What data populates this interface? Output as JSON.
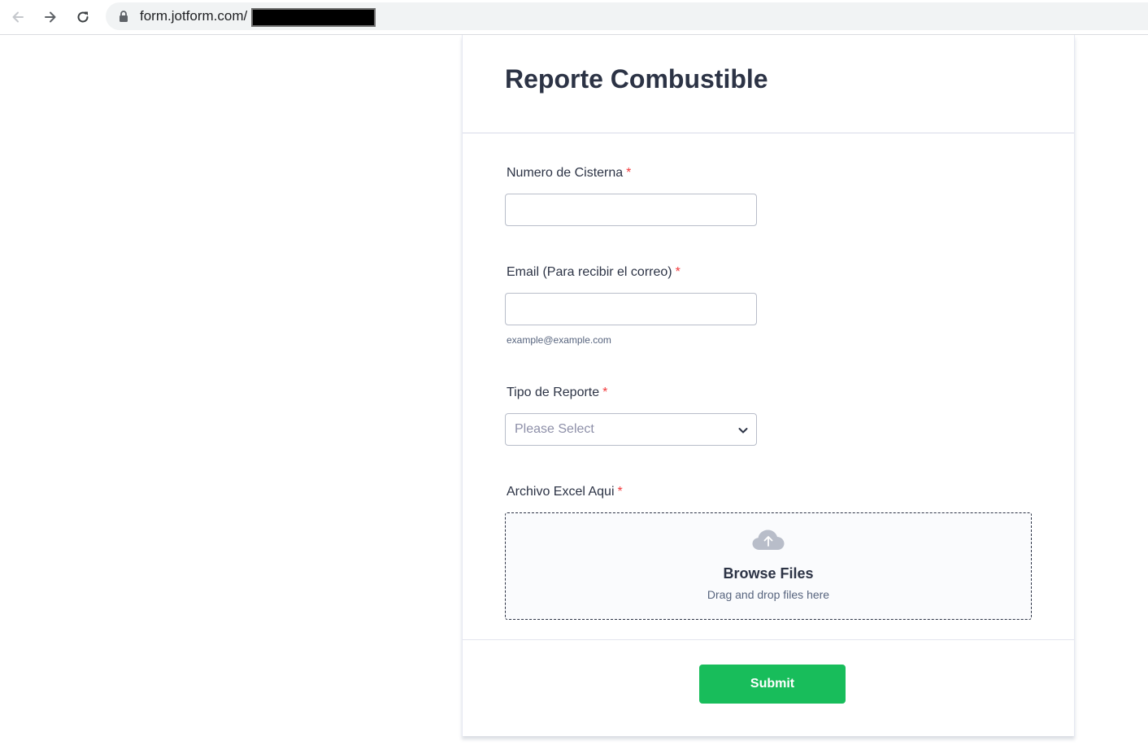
{
  "browser": {
    "url": "form.jotform.com/"
  },
  "form": {
    "title": "Reporte Combustible",
    "required_marker": "*",
    "fields": {
      "cisterna": {
        "label": "Numero de Cisterna",
        "value": ""
      },
      "email": {
        "label": "Email (Para recibir el correo)",
        "value": "",
        "sublabel": "example@example.com"
      },
      "tipo_reporte": {
        "label": "Tipo de Reporte",
        "placeholder": "Please Select"
      },
      "archivo": {
        "label": "Archivo Excel Aqui",
        "browse_label": "Browse Files",
        "drop_hint": "Drag and drop files here"
      }
    },
    "submit_label": "Submit"
  },
  "colors": {
    "submit": "#18bd5b",
    "required": "#f23a3c",
    "text": "#2c3345"
  },
  "icons": [
    "back-arrow-icon",
    "forward-arrow-icon",
    "reload-icon",
    "lock-icon",
    "chevron-down-icon",
    "cloud-upload-icon"
  ]
}
